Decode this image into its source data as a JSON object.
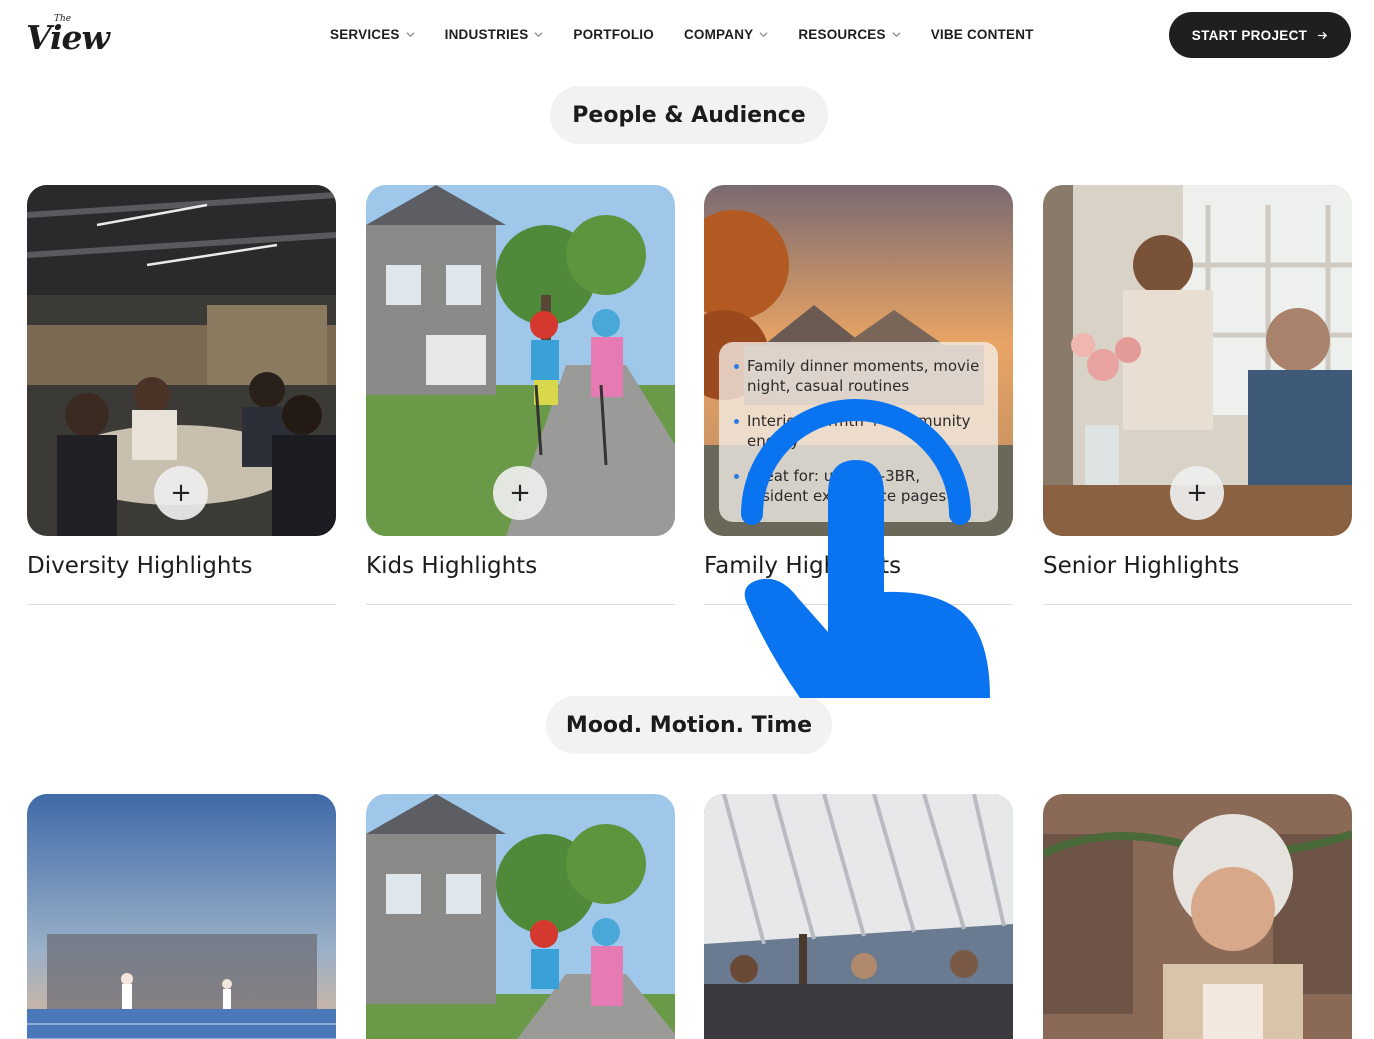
{
  "header": {
    "logo_small": "The",
    "logo_big": "View",
    "nav": [
      {
        "label": "SERVICES",
        "has_dropdown": true
      },
      {
        "label": "INDUSTRIES",
        "has_dropdown": true
      },
      {
        "label": "PORTFOLIO",
        "has_dropdown": false
      },
      {
        "label": "COMPANY",
        "has_dropdown": true
      },
      {
        "label": "RESOURCES",
        "has_dropdown": true
      },
      {
        "label": "VIBE CONTENT",
        "has_dropdown": false
      }
    ],
    "cta_label": "START PROJECT"
  },
  "sections": [
    {
      "title": "People & Audience",
      "cards": [
        {
          "title": "Diversity Highlights",
          "image": "restaurant-toast-photo"
        },
        {
          "title": "Kids Highlights",
          "image": "kids-scooters-photo"
        },
        {
          "title": "Family Highlights",
          "image": "sunset-houses-photo",
          "bullets": [
            "Family dinner moments, movie night, casual routines",
            "Interior warmth + community energy",
            "Great for: units, 2-3BR, resident experience pages"
          ]
        },
        {
          "title": "Senior Highlights",
          "image": "couple-flowers-photo"
        }
      ]
    },
    {
      "title": "Mood. Motion. Time",
      "cards": [
        {
          "image": "padel-court-photo"
        },
        {
          "image": "kids-scooters-photo"
        },
        {
          "image": "pergola-friends-photo"
        },
        {
          "image": "grandmother-kitchen-photo"
        }
      ]
    }
  ],
  "plus_symbol": "+",
  "colors": {
    "cta_bg": "#1f1f1f",
    "pill_bg": "#f2f2f2",
    "bullet": "#2b7bde",
    "tap_gesture": "#0a74f0"
  },
  "icons": [
    "chevron-down-icon",
    "arrow-right-icon",
    "plus-icon",
    "tap-hand-icon"
  ]
}
